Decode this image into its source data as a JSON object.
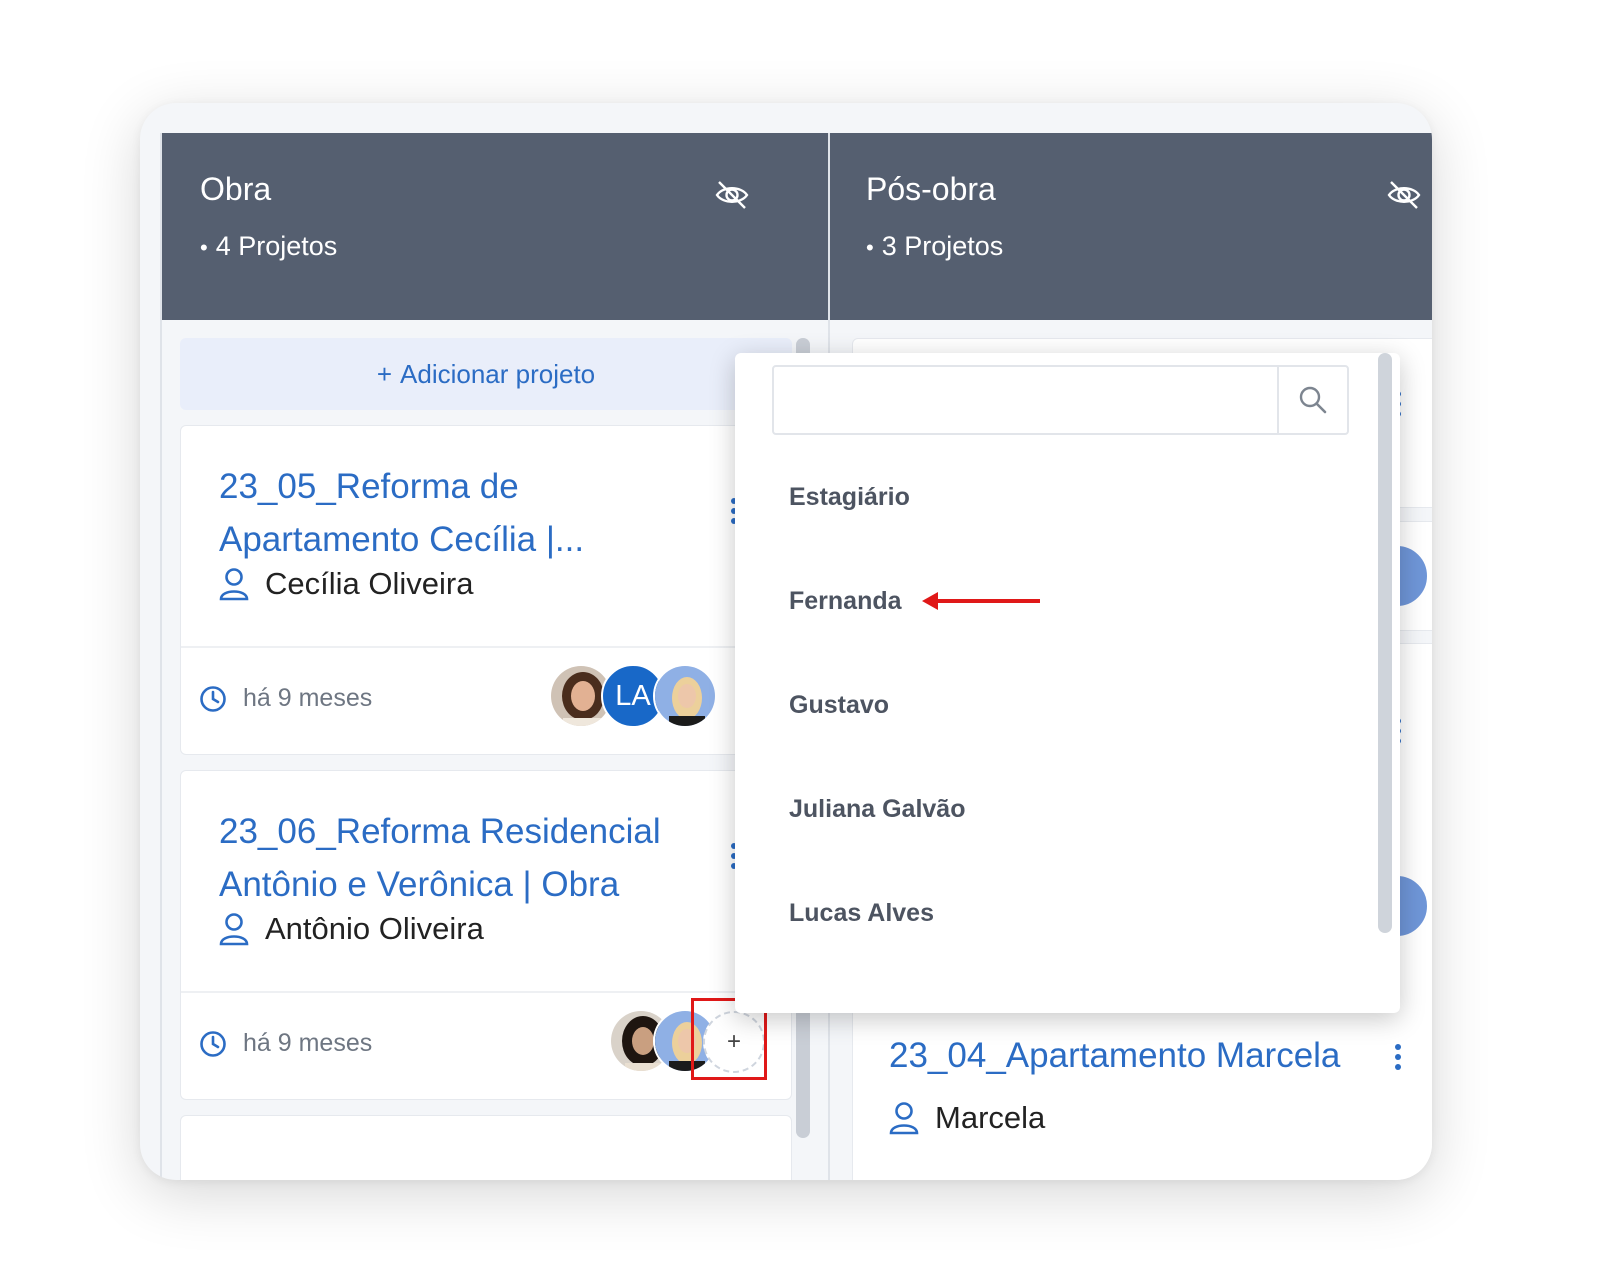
{
  "columns": [
    {
      "title": "Obra",
      "count_label": "4 Projetos",
      "visibility_icon": "eye-slash-icon"
    },
    {
      "title": "Pós-obra",
      "count_label": "3 Projetos",
      "visibility_icon": "eye-slash-icon"
    }
  ],
  "add_project": {
    "icon": "+",
    "label": "Adicionar projeto"
  },
  "cards": [
    {
      "title": "23_05_Reforma de Apartamento Cecília |...",
      "client": "Cecília Oliveira",
      "time": "há 9 meses",
      "member_initials": "LA"
    },
    {
      "title": "23_06_Reforma Residencial Antônio e Verônica | Obra",
      "client": "Antônio Oliveira",
      "time": "há 9 meses",
      "add_member_label": "+"
    }
  ],
  "right_card": {
    "title": "23_04_Apartamento Marcela",
    "client": "Marcela"
  },
  "dropdown": {
    "search_placeholder": "",
    "items": [
      "Estagiário",
      "Fernanda",
      "Gustavo",
      "Juliana Galvão",
      "Lucas Alves"
    ]
  },
  "colors": {
    "header_bg": "#555f70",
    "link_blue": "#2b6cc4",
    "avatar_blue": "#1868c8",
    "highlight_red": "#e01818"
  }
}
